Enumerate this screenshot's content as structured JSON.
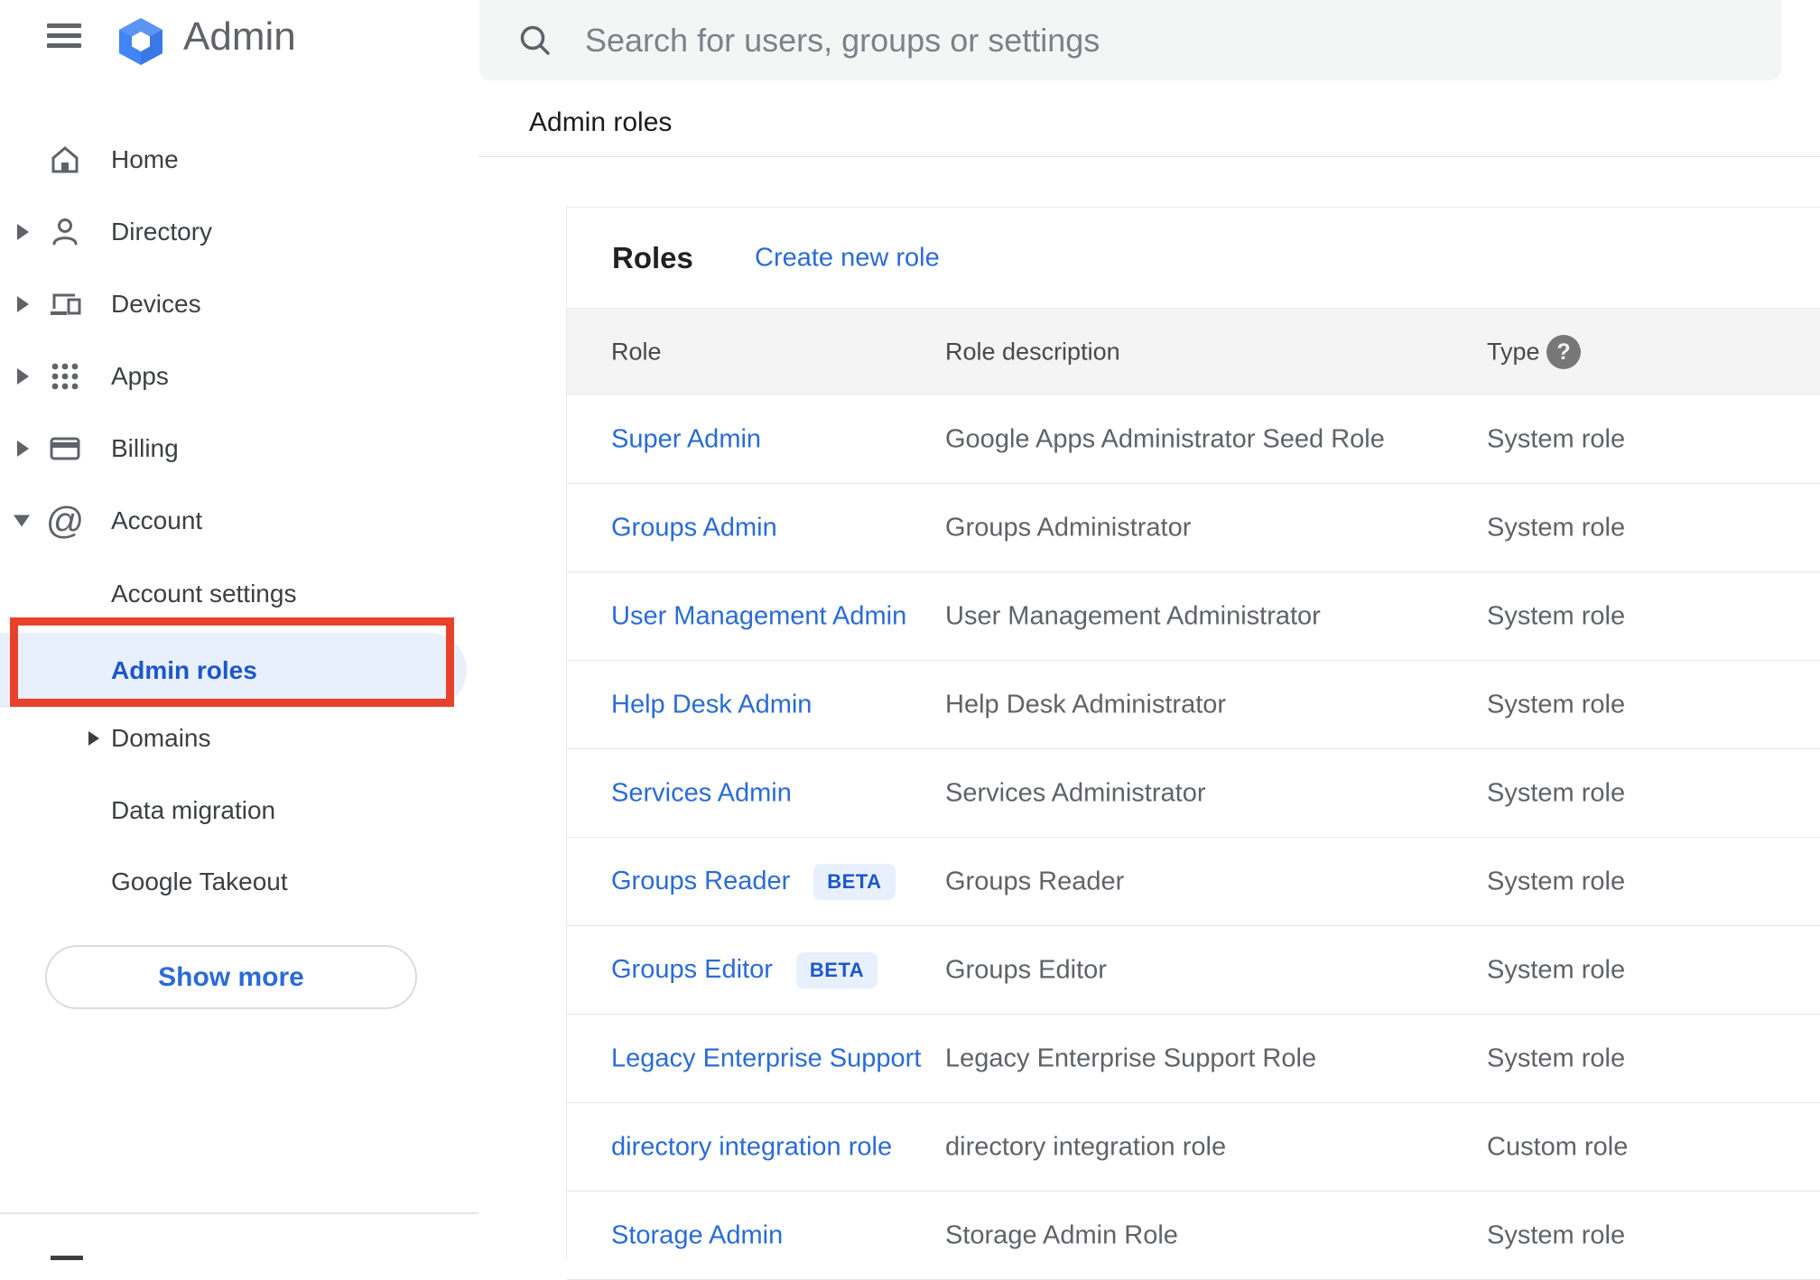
{
  "app": {
    "title": "Admin"
  },
  "search": {
    "placeholder": "Search for users, groups or settings"
  },
  "breadcrumb": "Admin roles",
  "sidebar": {
    "items": [
      {
        "label": "Home",
        "icon": "home-icon",
        "expandable": false
      },
      {
        "label": "Directory",
        "icon": "directory-icon",
        "expandable": true
      },
      {
        "label": "Devices",
        "icon": "devices-icon",
        "expandable": true
      },
      {
        "label": "Apps",
        "icon": "apps-icon",
        "expandable": true
      },
      {
        "label": "Billing",
        "icon": "billing-icon",
        "expandable": true
      },
      {
        "label": "Account",
        "icon": "account-icon",
        "expanded": true
      },
      {
        "label": "Account settings",
        "sub": true
      },
      {
        "label": "Admin roles",
        "sub": true,
        "selected": true
      },
      {
        "label": "Domains",
        "sub": true,
        "expandable": true
      },
      {
        "label": "Data migration",
        "sub": true
      },
      {
        "label": "Google Takeout",
        "sub": true
      }
    ],
    "show_more_label": "Show more"
  },
  "main": {
    "card_title": "Roles",
    "create_link": "Create new role",
    "table": {
      "columns": [
        "Role",
        "Role description",
        "Type"
      ],
      "rows": [
        {
          "role": "Super Admin",
          "description": "Google Apps Administrator Seed Role",
          "type": "System role"
        },
        {
          "role": "Groups Admin",
          "description": "Groups Administrator",
          "type": "System role"
        },
        {
          "role": "User Management Admin",
          "description": "User Management Administrator",
          "type": "System role"
        },
        {
          "role": "Help Desk Admin",
          "description": "Help Desk Administrator",
          "type": "System role"
        },
        {
          "role": "Services Admin",
          "description": "Services Administrator",
          "type": "System role"
        },
        {
          "role": "Groups Reader",
          "beta_label": "BETA",
          "description": "Groups Reader",
          "type": "System role"
        },
        {
          "role": "Groups Editor",
          "beta_label": "BETA",
          "description": "Groups Editor",
          "type": "System role"
        },
        {
          "role": "Legacy Enterprise Support",
          "description": "Legacy Enterprise Support Role",
          "type": "System role"
        },
        {
          "role": "directory integration role",
          "description": "directory integration role",
          "type": "Custom role"
        },
        {
          "role": "Storage Admin",
          "description": "Storage Admin Role",
          "type": "System role"
        }
      ]
    }
  },
  "annotation": {
    "highlighted_item": "Admin roles",
    "color": "#e8422c"
  },
  "colors": {
    "link_blue": "#2a6bd8",
    "selected_blue": "#1d56cb",
    "selected_bg": "#e8f0fe",
    "icon_gray": "#5f6368",
    "table_header_bg": "#f4f4f4",
    "search_bg": "#f4f5f5",
    "logo_blue": "#4285f4"
  }
}
